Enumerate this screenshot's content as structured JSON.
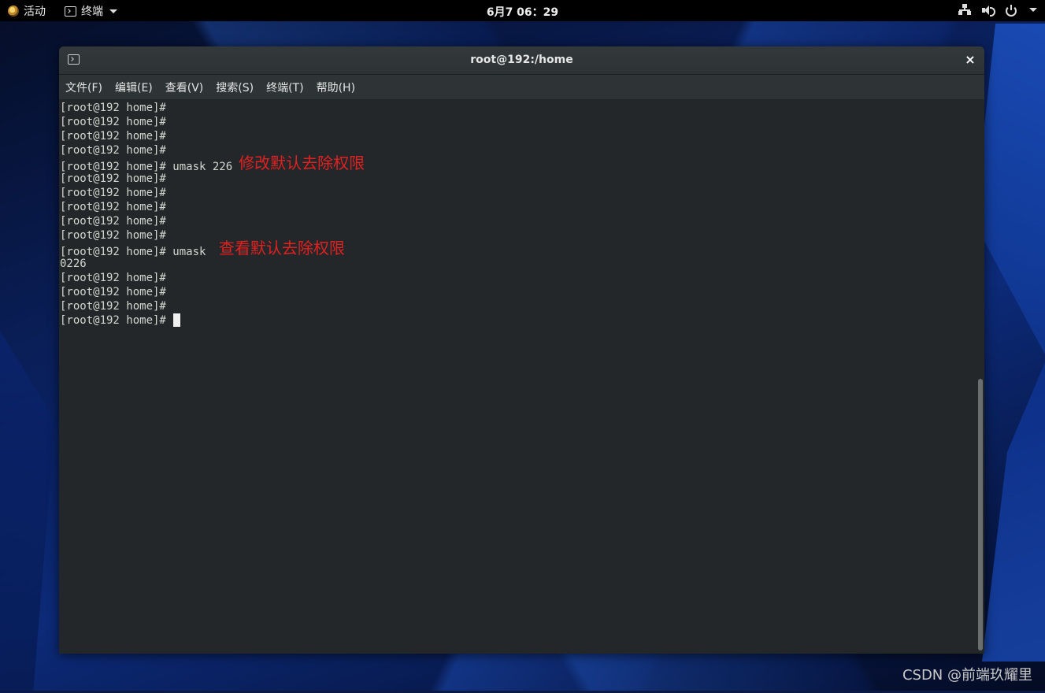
{
  "topbar": {
    "activities": "活动",
    "app_menu": "终端",
    "clock": "6月7  06：29",
    "icons": [
      "network-icon",
      "volume-icon",
      "power-icon"
    ]
  },
  "window": {
    "title": "root@192:/home",
    "close_symbol": "×",
    "menu": {
      "file": "文件(F)",
      "edit": "编辑(E)",
      "view": "查看(V)",
      "search": "搜索(S)",
      "terminal": "终端(T)",
      "help": "帮助(H)"
    }
  },
  "terminal": {
    "lines": [
      {
        "text": "[root@192 home]#",
        "note": ""
      },
      {
        "text": "[root@192 home]#",
        "note": ""
      },
      {
        "text": "[root@192 home]#",
        "note": ""
      },
      {
        "text": "[root@192 home]#",
        "note": ""
      },
      {
        "text": "[root@192 home]# umask 226",
        "note": "修改默认去除权限"
      },
      {
        "text": "[root@192 home]#",
        "note": ""
      },
      {
        "text": "[root@192 home]#",
        "note": ""
      },
      {
        "text": "[root@192 home]#",
        "note": ""
      },
      {
        "text": "[root@192 home]#",
        "note": ""
      },
      {
        "text": "[root@192 home]#",
        "note": ""
      },
      {
        "text": "[root@192 home]# umask ",
        "note": "查看默认去除权限"
      },
      {
        "text": "0226",
        "note": ""
      },
      {
        "text": "[root@192 home]#",
        "note": ""
      },
      {
        "text": "[root@192 home]#",
        "note": ""
      },
      {
        "text": "[root@192 home]#",
        "note": ""
      },
      {
        "text": "[root@192 home]# ",
        "note": ""
      }
    ],
    "annotation_color": "#e02121"
  },
  "watermark": "CSDN @前端玖耀里"
}
